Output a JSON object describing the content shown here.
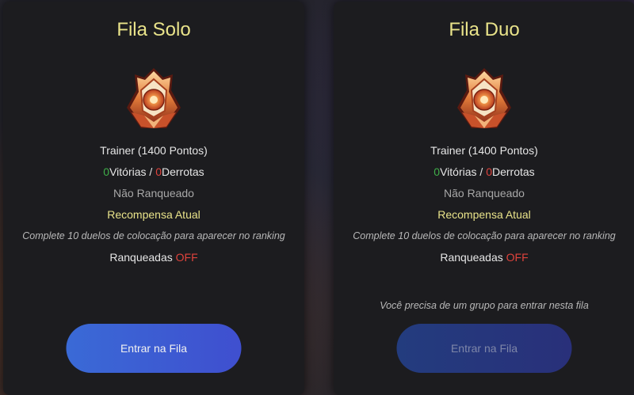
{
  "queues": [
    {
      "title": "Fila Solo",
      "rank": "Trainer (1400 Pontos)",
      "wins": "0",
      "wins_label": "Vitórias",
      "separator": " / ",
      "losses": "0",
      "losses_label": "Derrotas",
      "status": "Não Ranqueado",
      "reward_label": "Recompensa Atual",
      "placement_notice": "Complete 10 duelos de colocação para aparecer no ranking",
      "ranked_label": "Ranqueadas",
      "ranked_state": "OFF",
      "button_label": "Entrar na Fila",
      "button_enabled": true
    },
    {
      "title": "Fila Duo",
      "rank": "Trainer (1400 Pontos)",
      "wins": "0",
      "wins_label": "Vitórias",
      "separator": " / ",
      "losses": "0",
      "losses_label": "Derrotas",
      "status": "Não Ranqueado",
      "reward_label": "Recompensa Atual",
      "placement_notice": "Complete 10 duelos de colocação para aparecer no ranking",
      "ranked_label": "Ranqueadas",
      "ranked_state": "OFF",
      "group_notice": "Você precisa de um grupo para entrar nesta fila",
      "button_label": "Entrar na Fila",
      "button_enabled": false
    }
  ],
  "badge_icon": "trainer-rank-badge-icon",
  "colors": {
    "title": "#e9e38a",
    "win": "#3fae49",
    "loss": "#e0433c",
    "button": "#3a6ad6"
  }
}
